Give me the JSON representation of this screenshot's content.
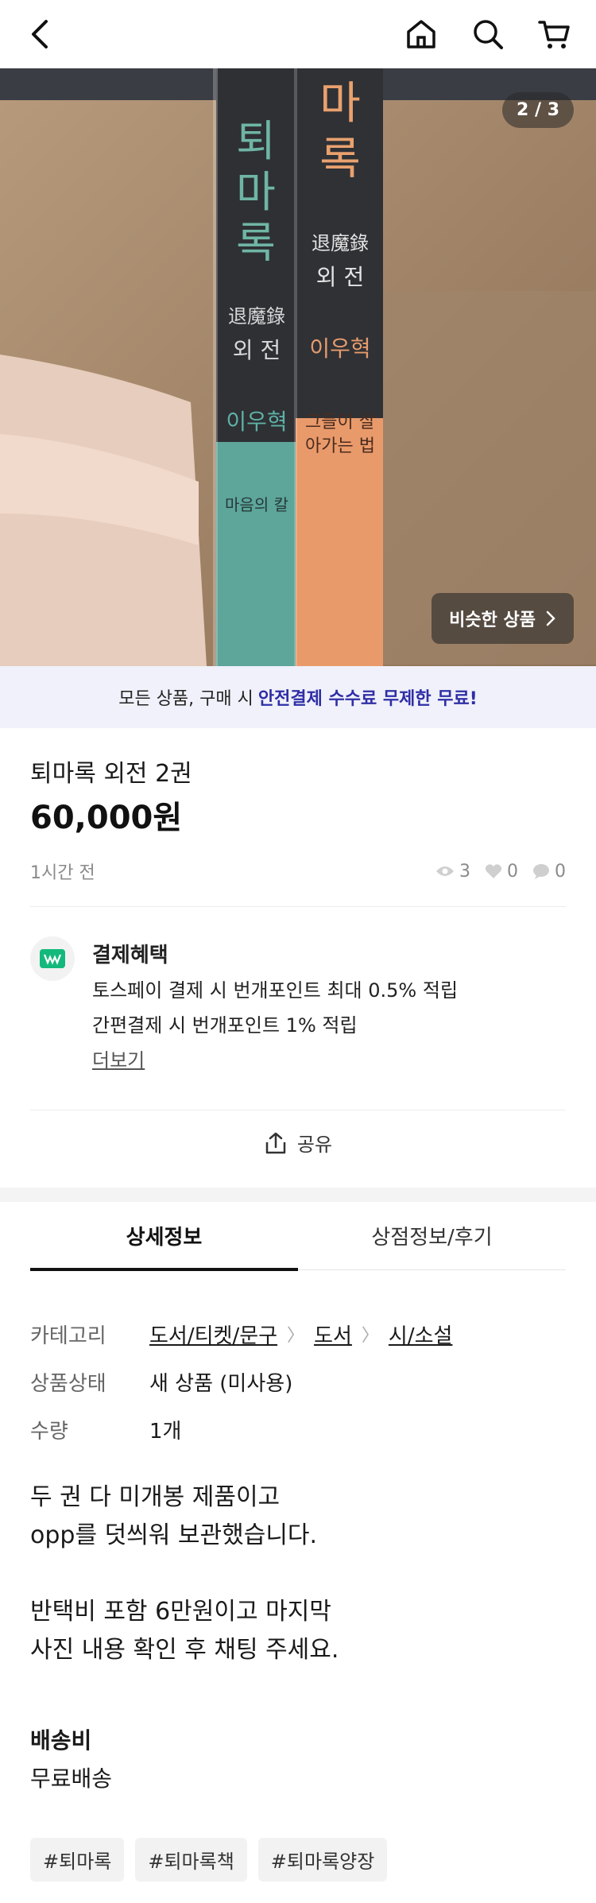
{
  "header": {
    "back_icon": "chevron-left-icon",
    "home_icon": "home-icon",
    "search_icon": "search-icon",
    "cart_icon": "cart-icon"
  },
  "image": {
    "page_indicator": "2 / 3",
    "similar_button": "비슷한 상품",
    "book_spine_texts": {
      "left": {
        "top": "퇴마록",
        "hanja": "退魔錄",
        "sub": "외 전",
        "author": "이우혁",
        "bottom": "마음의 칼"
      },
      "right": {
        "top": "마록",
        "hanja": "退魔錄",
        "sub": "외 전",
        "author": "이우혁",
        "bottom": "그들이 살아가는 법"
      }
    }
  },
  "banner": {
    "text": "모든 상품, 구매 시",
    "highlight": "안전결제 수수료 무제한 무료!"
  },
  "product": {
    "title": "퇴마록 외전 2권",
    "price": "60,000원",
    "time_ago": "1시간 전",
    "views": "3",
    "likes": "0",
    "chats": "0"
  },
  "benefit": {
    "heading": "결제혜택",
    "line1": "토스페이 결제 시 번개포인트 최대 0.5% 적립",
    "line2": "간편결제 시 번개포인트 1% 적립",
    "more": "더보기"
  },
  "share": {
    "label": "공유"
  },
  "tabs": [
    {
      "label": "상세정보"
    },
    {
      "label": "상점정보/후기"
    }
  ],
  "details": {
    "category_label": "카테고리",
    "category_path": [
      "도서/티켓/문구",
      "도서",
      "시/소설"
    ],
    "condition_label": "상품상태",
    "condition_value": "새 상품 (미사용)",
    "quantity_label": "수량",
    "quantity_value": "1개"
  },
  "description": {
    "p1_line1": "두 권 다 미개봉 제품이고",
    "p1_line2": "opp를 덧씌워 보관했습니다.",
    "p2_line1": "반택비 포함 6만원이고 마지막",
    "p2_line2": "사진 내용 확인 후 채팅 주세요."
  },
  "shipping": {
    "heading": "배송비",
    "value": "무료배송"
  },
  "tags": [
    "#퇴마록",
    "#퇴마록책",
    "#퇴마록양장"
  ]
}
